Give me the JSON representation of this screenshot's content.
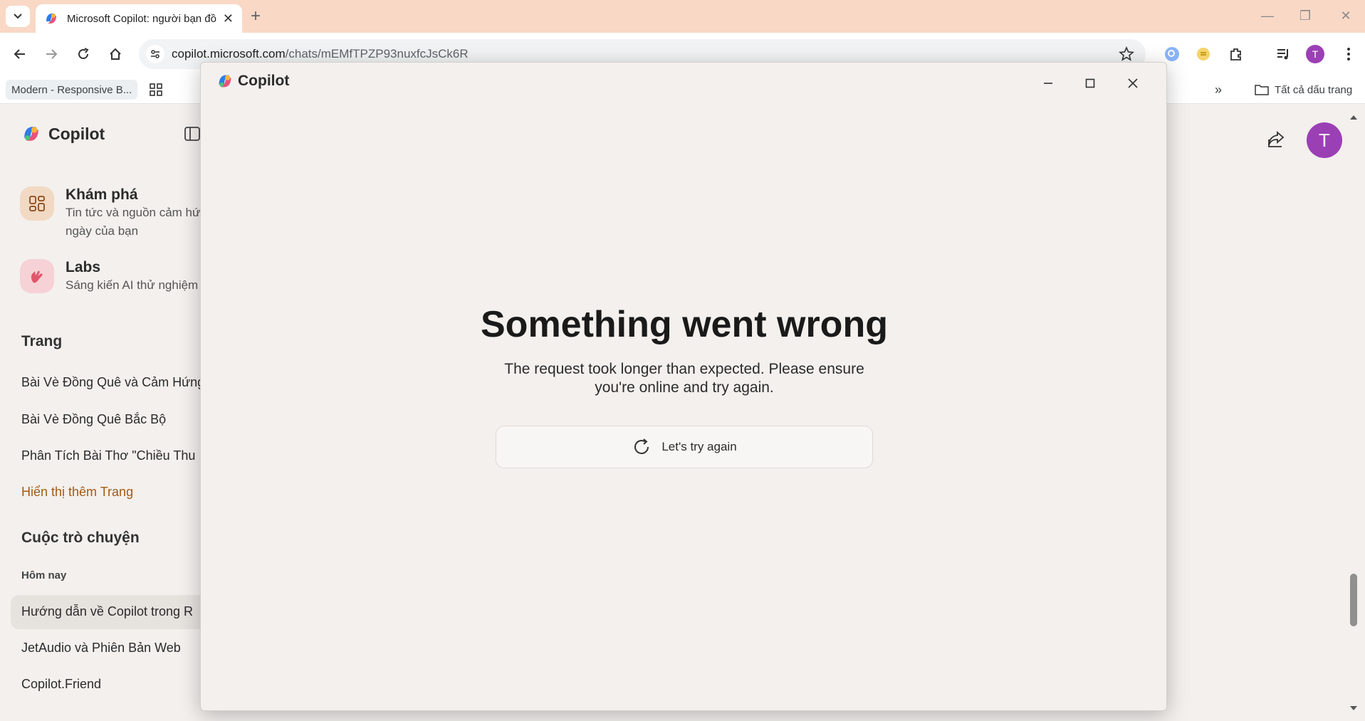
{
  "browser": {
    "tab_title": "Microsoft Copilot: người bạn đồng hành AI",
    "url_domain": "copilot.microsoft.com",
    "url_path": "/chats/mEMfTPZP93nuxfcJsCk6R",
    "profile_initial": "T",
    "bookmarks": {
      "first": "Modern - Responsive B...",
      "all_bookmarks": "Tất cả dấu trang"
    }
  },
  "sidebar": {
    "app_name": "Copilot",
    "features": [
      {
        "title": "Khám phá",
        "desc_line1": "Tin tức và nguồn cảm hứng",
        "desc_line2": "ngày của bạn",
        "icon": "grid-icon"
      },
      {
        "title": "Labs",
        "desc_line1": "Sáng kiến AI thử nghiệm",
        "icon": "labs-hand-icon"
      }
    ],
    "pages_heading": "Trang",
    "pages": [
      "Bài Vè Đồng Quê và Cảm Hứng",
      "Bài Vè Đồng Quê Bắc Bộ",
      "Phân Tích Bài Thơ \"Chiều Thu"
    ],
    "show_more_pages": "Hiển thị thêm Trang",
    "conversations_heading": "Cuộc trò chuyện",
    "today_label": "Hôm nay",
    "conversations": [
      "Hướng dẫn về Copilot trong R",
      "JetAudio và Phiên Bản Web",
      "Copilot.Friend"
    ]
  },
  "header": {
    "avatar_initial": "T"
  },
  "modal": {
    "title": "Copilot",
    "error_title": "Something went wrong",
    "error_line1": "The request took longer than expected. Please ensure",
    "error_line2": "you're online and try again.",
    "retry_label": "Let's try again"
  },
  "colors": {
    "tabstrip": "#f9d8c6",
    "page_bg": "#f3f0ed",
    "accent_link": "#a45a15",
    "avatar": "#9b3fb5"
  }
}
